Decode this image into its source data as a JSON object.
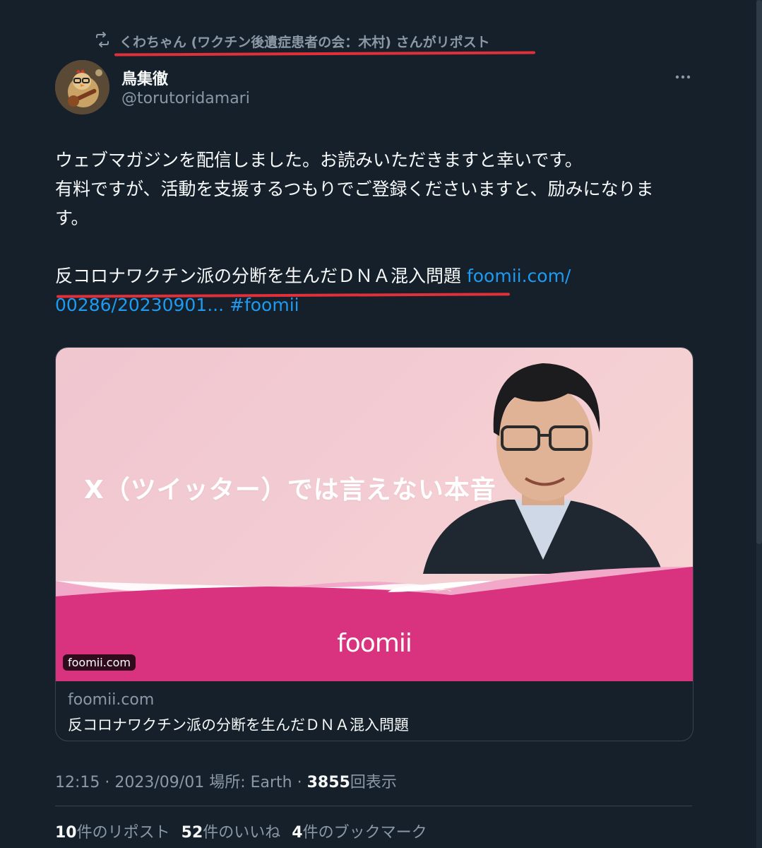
{
  "repost": {
    "label": "くわちゃん (ワクチン後遺症患者の会：木村) さんがリポスト",
    "icon": "repost-icon"
  },
  "author": {
    "display_name": "鳥集徹",
    "handle": "@torutoridamari",
    "avatar_icon": "avatar-chicken-guitar"
  },
  "tweet": {
    "line1": "ウェブマガジンを配信しました。お読みいただきますと幸いです。",
    "line2": "有料ですが、活動を支援するつもりでご登録くださいますと、励みになりま",
    "line3": "す。",
    "line4_text": "反コロナワクチン派の分断を生んだＤＮＡ混入問題 ",
    "line4_link": "foomii.com/",
    "line5_link": "00286/20230901...",
    "hashtag": "#foomii"
  },
  "card": {
    "headline": "X（ツイッター）では言えない本音",
    "logo": "foomii",
    "badge": "foomii.com",
    "domain": "foomii.com",
    "title": "反コロナワクチン派の分断を生んだＤＮＡ混入問題"
  },
  "meta": {
    "time": "12:15",
    "date": "2023/09/01",
    "location_label": "場所: Earth",
    "views_count": "3855",
    "views_label": "回表示"
  },
  "stats": {
    "reposts_count": "10",
    "reposts_label": "件のリポスト",
    "likes_count": "52",
    "likes_label": "件のいいね",
    "bookmarks_count": "4",
    "bookmarks_label": "件のブックマーク"
  },
  "colors": {
    "background": "#15202b",
    "link": "#1d9bf0",
    "underline_annotation": "#e0303a",
    "card_pink": "#d9337f"
  }
}
